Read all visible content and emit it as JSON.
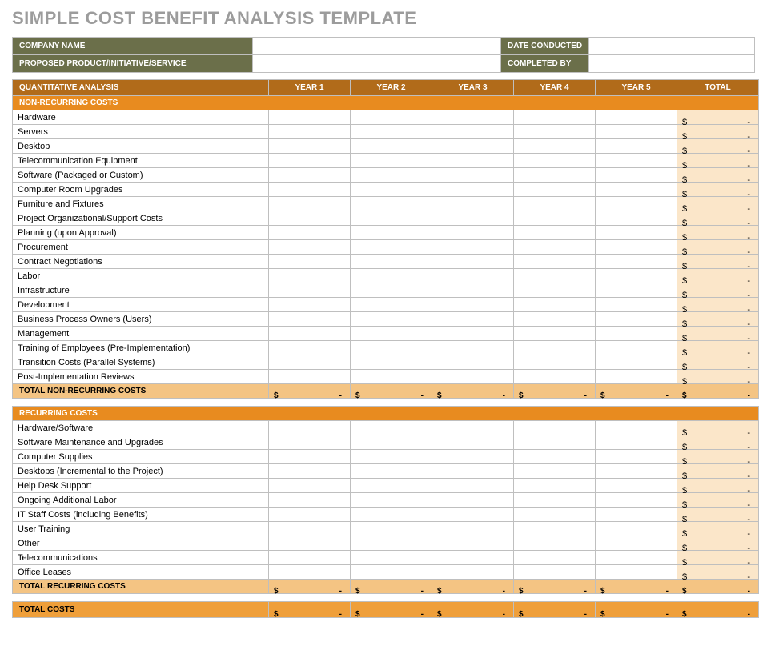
{
  "title": "SIMPLE COST BENEFIT ANALYSIS TEMPLATE",
  "info": {
    "company_label": "COMPANY NAME",
    "date_label": "DATE CONDUCTED",
    "proposed_label": "PROPOSED PRODUCT/INITIATIVE/SERVICE",
    "completed_label": "COMPLETED BY"
  },
  "columns": {
    "analysis": "QUANTITATIVE ANALYSIS",
    "y1": "YEAR 1",
    "y2": "YEAR 2",
    "y3": "YEAR 3",
    "y4": "YEAR 4",
    "y5": "YEAR 5",
    "total": "TOTAL"
  },
  "section_nonrecurring": "NON-RECURRING COSTS",
  "nonrecurring": [
    "Hardware",
    "Servers",
    "Desktop",
    "Telecommunication Equipment",
    "Software (Packaged or Custom)",
    "Computer Room Upgrades",
    "Furniture and Fixtures",
    "Project Organizational/Support Costs",
    "Planning (upon Approval)",
    "Procurement",
    "Contract Negotiations",
    "Labor",
    "Infrastructure",
    "Development",
    "Business Process Owners (Users)",
    "Management",
    "Training of Employees (Pre-Implementation)",
    "Transition Costs (Parallel Systems)",
    "Post-Implementation Reviews"
  ],
  "subtotal_nonrecurring": "TOTAL NON-RECURRING COSTS",
  "section_recurring": "RECURRING COSTS",
  "recurring": [
    "Hardware/Software",
    "Software Maintenance and Upgrades",
    "Computer Supplies",
    "Desktops (Incremental to the Project)",
    "Help Desk Support",
    "Ongoing Additional Labor",
    "IT Staff Costs (including Benefits)",
    "User Training",
    "Other",
    "Telecommunications",
    "Office Leases"
  ],
  "subtotal_recurring": "TOTAL RECURRING COSTS",
  "grand": "TOTAL COSTS",
  "currency": "$",
  "empty": "-"
}
